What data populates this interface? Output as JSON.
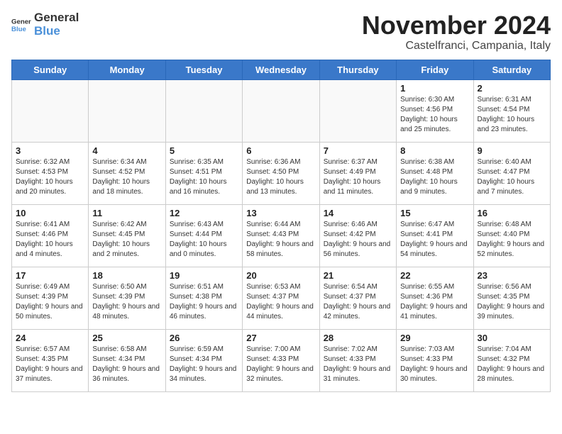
{
  "logo": {
    "general": "General",
    "blue": "Blue"
  },
  "title": "November 2024",
  "subtitle": "Castelfranci, Campania, Italy",
  "days_of_week": [
    "Sunday",
    "Monday",
    "Tuesday",
    "Wednesday",
    "Thursday",
    "Friday",
    "Saturday"
  ],
  "weeks": [
    [
      {
        "day": "",
        "info": ""
      },
      {
        "day": "",
        "info": ""
      },
      {
        "day": "",
        "info": ""
      },
      {
        "day": "",
        "info": ""
      },
      {
        "day": "",
        "info": ""
      },
      {
        "day": "1",
        "info": "Sunrise: 6:30 AM\nSunset: 4:56 PM\nDaylight: 10 hours and 25 minutes."
      },
      {
        "day": "2",
        "info": "Sunrise: 6:31 AM\nSunset: 4:54 PM\nDaylight: 10 hours and 23 minutes."
      }
    ],
    [
      {
        "day": "3",
        "info": "Sunrise: 6:32 AM\nSunset: 4:53 PM\nDaylight: 10 hours and 20 minutes."
      },
      {
        "day": "4",
        "info": "Sunrise: 6:34 AM\nSunset: 4:52 PM\nDaylight: 10 hours and 18 minutes."
      },
      {
        "day": "5",
        "info": "Sunrise: 6:35 AM\nSunset: 4:51 PM\nDaylight: 10 hours and 16 minutes."
      },
      {
        "day": "6",
        "info": "Sunrise: 6:36 AM\nSunset: 4:50 PM\nDaylight: 10 hours and 13 minutes."
      },
      {
        "day": "7",
        "info": "Sunrise: 6:37 AM\nSunset: 4:49 PM\nDaylight: 10 hours and 11 minutes."
      },
      {
        "day": "8",
        "info": "Sunrise: 6:38 AM\nSunset: 4:48 PM\nDaylight: 10 hours and 9 minutes."
      },
      {
        "day": "9",
        "info": "Sunrise: 6:40 AM\nSunset: 4:47 PM\nDaylight: 10 hours and 7 minutes."
      }
    ],
    [
      {
        "day": "10",
        "info": "Sunrise: 6:41 AM\nSunset: 4:46 PM\nDaylight: 10 hours and 4 minutes."
      },
      {
        "day": "11",
        "info": "Sunrise: 6:42 AM\nSunset: 4:45 PM\nDaylight: 10 hours and 2 minutes."
      },
      {
        "day": "12",
        "info": "Sunrise: 6:43 AM\nSunset: 4:44 PM\nDaylight: 10 hours and 0 minutes."
      },
      {
        "day": "13",
        "info": "Sunrise: 6:44 AM\nSunset: 4:43 PM\nDaylight: 9 hours and 58 minutes."
      },
      {
        "day": "14",
        "info": "Sunrise: 6:46 AM\nSunset: 4:42 PM\nDaylight: 9 hours and 56 minutes."
      },
      {
        "day": "15",
        "info": "Sunrise: 6:47 AM\nSunset: 4:41 PM\nDaylight: 9 hours and 54 minutes."
      },
      {
        "day": "16",
        "info": "Sunrise: 6:48 AM\nSunset: 4:40 PM\nDaylight: 9 hours and 52 minutes."
      }
    ],
    [
      {
        "day": "17",
        "info": "Sunrise: 6:49 AM\nSunset: 4:39 PM\nDaylight: 9 hours and 50 minutes."
      },
      {
        "day": "18",
        "info": "Sunrise: 6:50 AM\nSunset: 4:39 PM\nDaylight: 9 hours and 48 minutes."
      },
      {
        "day": "19",
        "info": "Sunrise: 6:51 AM\nSunset: 4:38 PM\nDaylight: 9 hours and 46 minutes."
      },
      {
        "day": "20",
        "info": "Sunrise: 6:53 AM\nSunset: 4:37 PM\nDaylight: 9 hours and 44 minutes."
      },
      {
        "day": "21",
        "info": "Sunrise: 6:54 AM\nSunset: 4:37 PM\nDaylight: 9 hours and 42 minutes."
      },
      {
        "day": "22",
        "info": "Sunrise: 6:55 AM\nSunset: 4:36 PM\nDaylight: 9 hours and 41 minutes."
      },
      {
        "day": "23",
        "info": "Sunrise: 6:56 AM\nSunset: 4:35 PM\nDaylight: 9 hours and 39 minutes."
      }
    ],
    [
      {
        "day": "24",
        "info": "Sunrise: 6:57 AM\nSunset: 4:35 PM\nDaylight: 9 hours and 37 minutes."
      },
      {
        "day": "25",
        "info": "Sunrise: 6:58 AM\nSunset: 4:34 PM\nDaylight: 9 hours and 36 minutes."
      },
      {
        "day": "26",
        "info": "Sunrise: 6:59 AM\nSunset: 4:34 PM\nDaylight: 9 hours and 34 minutes."
      },
      {
        "day": "27",
        "info": "Sunrise: 7:00 AM\nSunset: 4:33 PM\nDaylight: 9 hours and 32 minutes."
      },
      {
        "day": "28",
        "info": "Sunrise: 7:02 AM\nSunset: 4:33 PM\nDaylight: 9 hours and 31 minutes."
      },
      {
        "day": "29",
        "info": "Sunrise: 7:03 AM\nSunset: 4:33 PM\nDaylight: 9 hours and 30 minutes."
      },
      {
        "day": "30",
        "info": "Sunrise: 7:04 AM\nSunset: 4:32 PM\nDaylight: 9 hours and 28 minutes."
      }
    ]
  ]
}
